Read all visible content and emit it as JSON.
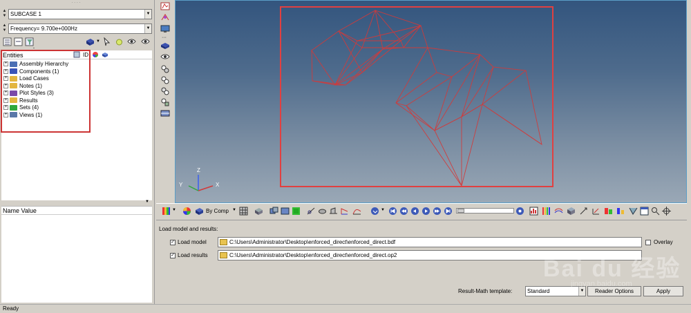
{
  "left_panel": {
    "subcase_select": "SUBCASE 1",
    "frequency_select": "Frequency=  9.700e+000Hz",
    "entities_header": "Entities",
    "id_header": "ID",
    "tree": [
      {
        "label": "Assembly Hierarchy",
        "color": "#4b6fb4"
      },
      {
        "label": "Components (1)",
        "color": "#3a54b8"
      },
      {
        "label": "Load Cases",
        "color": "#e3b640"
      },
      {
        "label": "Notes (1)",
        "color": "#e3b640"
      },
      {
        "label": "Plot Styles (3)",
        "color": "#7a4aa8"
      },
      {
        "label": "Results",
        "color": "#e3b640"
      },
      {
        "label": "Sets  (4)",
        "color": "#2fa83c"
      },
      {
        "label": "Views (1)",
        "color": "#5a78a8"
      }
    ],
    "name_value_header": "Name Value"
  },
  "viewport": {
    "triad": {
      "z": "Z",
      "y": "Y",
      "x": "X"
    },
    "background_top": "#33557e",
    "model_color": "#d23a3a"
  },
  "bottom_toolbar": {
    "color_mode": "By Comp"
  },
  "load_panel": {
    "section_title": "Load model and results:",
    "load_model_label": "Load model",
    "load_model_checked": true,
    "load_model_path": "C:\\Users\\Administrator\\Desktop\\enforced_direct\\enforced_direct.bdf",
    "overlay_label": "Overlay",
    "load_results_label": "Load results",
    "load_results_checked": true,
    "load_results_path": "C:\\Users\\Administrator\\Desktop\\enforced_direct\\enforced_direct.op2",
    "template_label": "Result-Math template:",
    "template_value": "Standard",
    "reader_options_button": "Reader Options",
    "apply_button": "Apply"
  },
  "status_bar": {
    "text": "Ready"
  },
  "watermark": {
    "text": "Bai du 经验",
    "sub": "jingyan.baidu.com"
  }
}
